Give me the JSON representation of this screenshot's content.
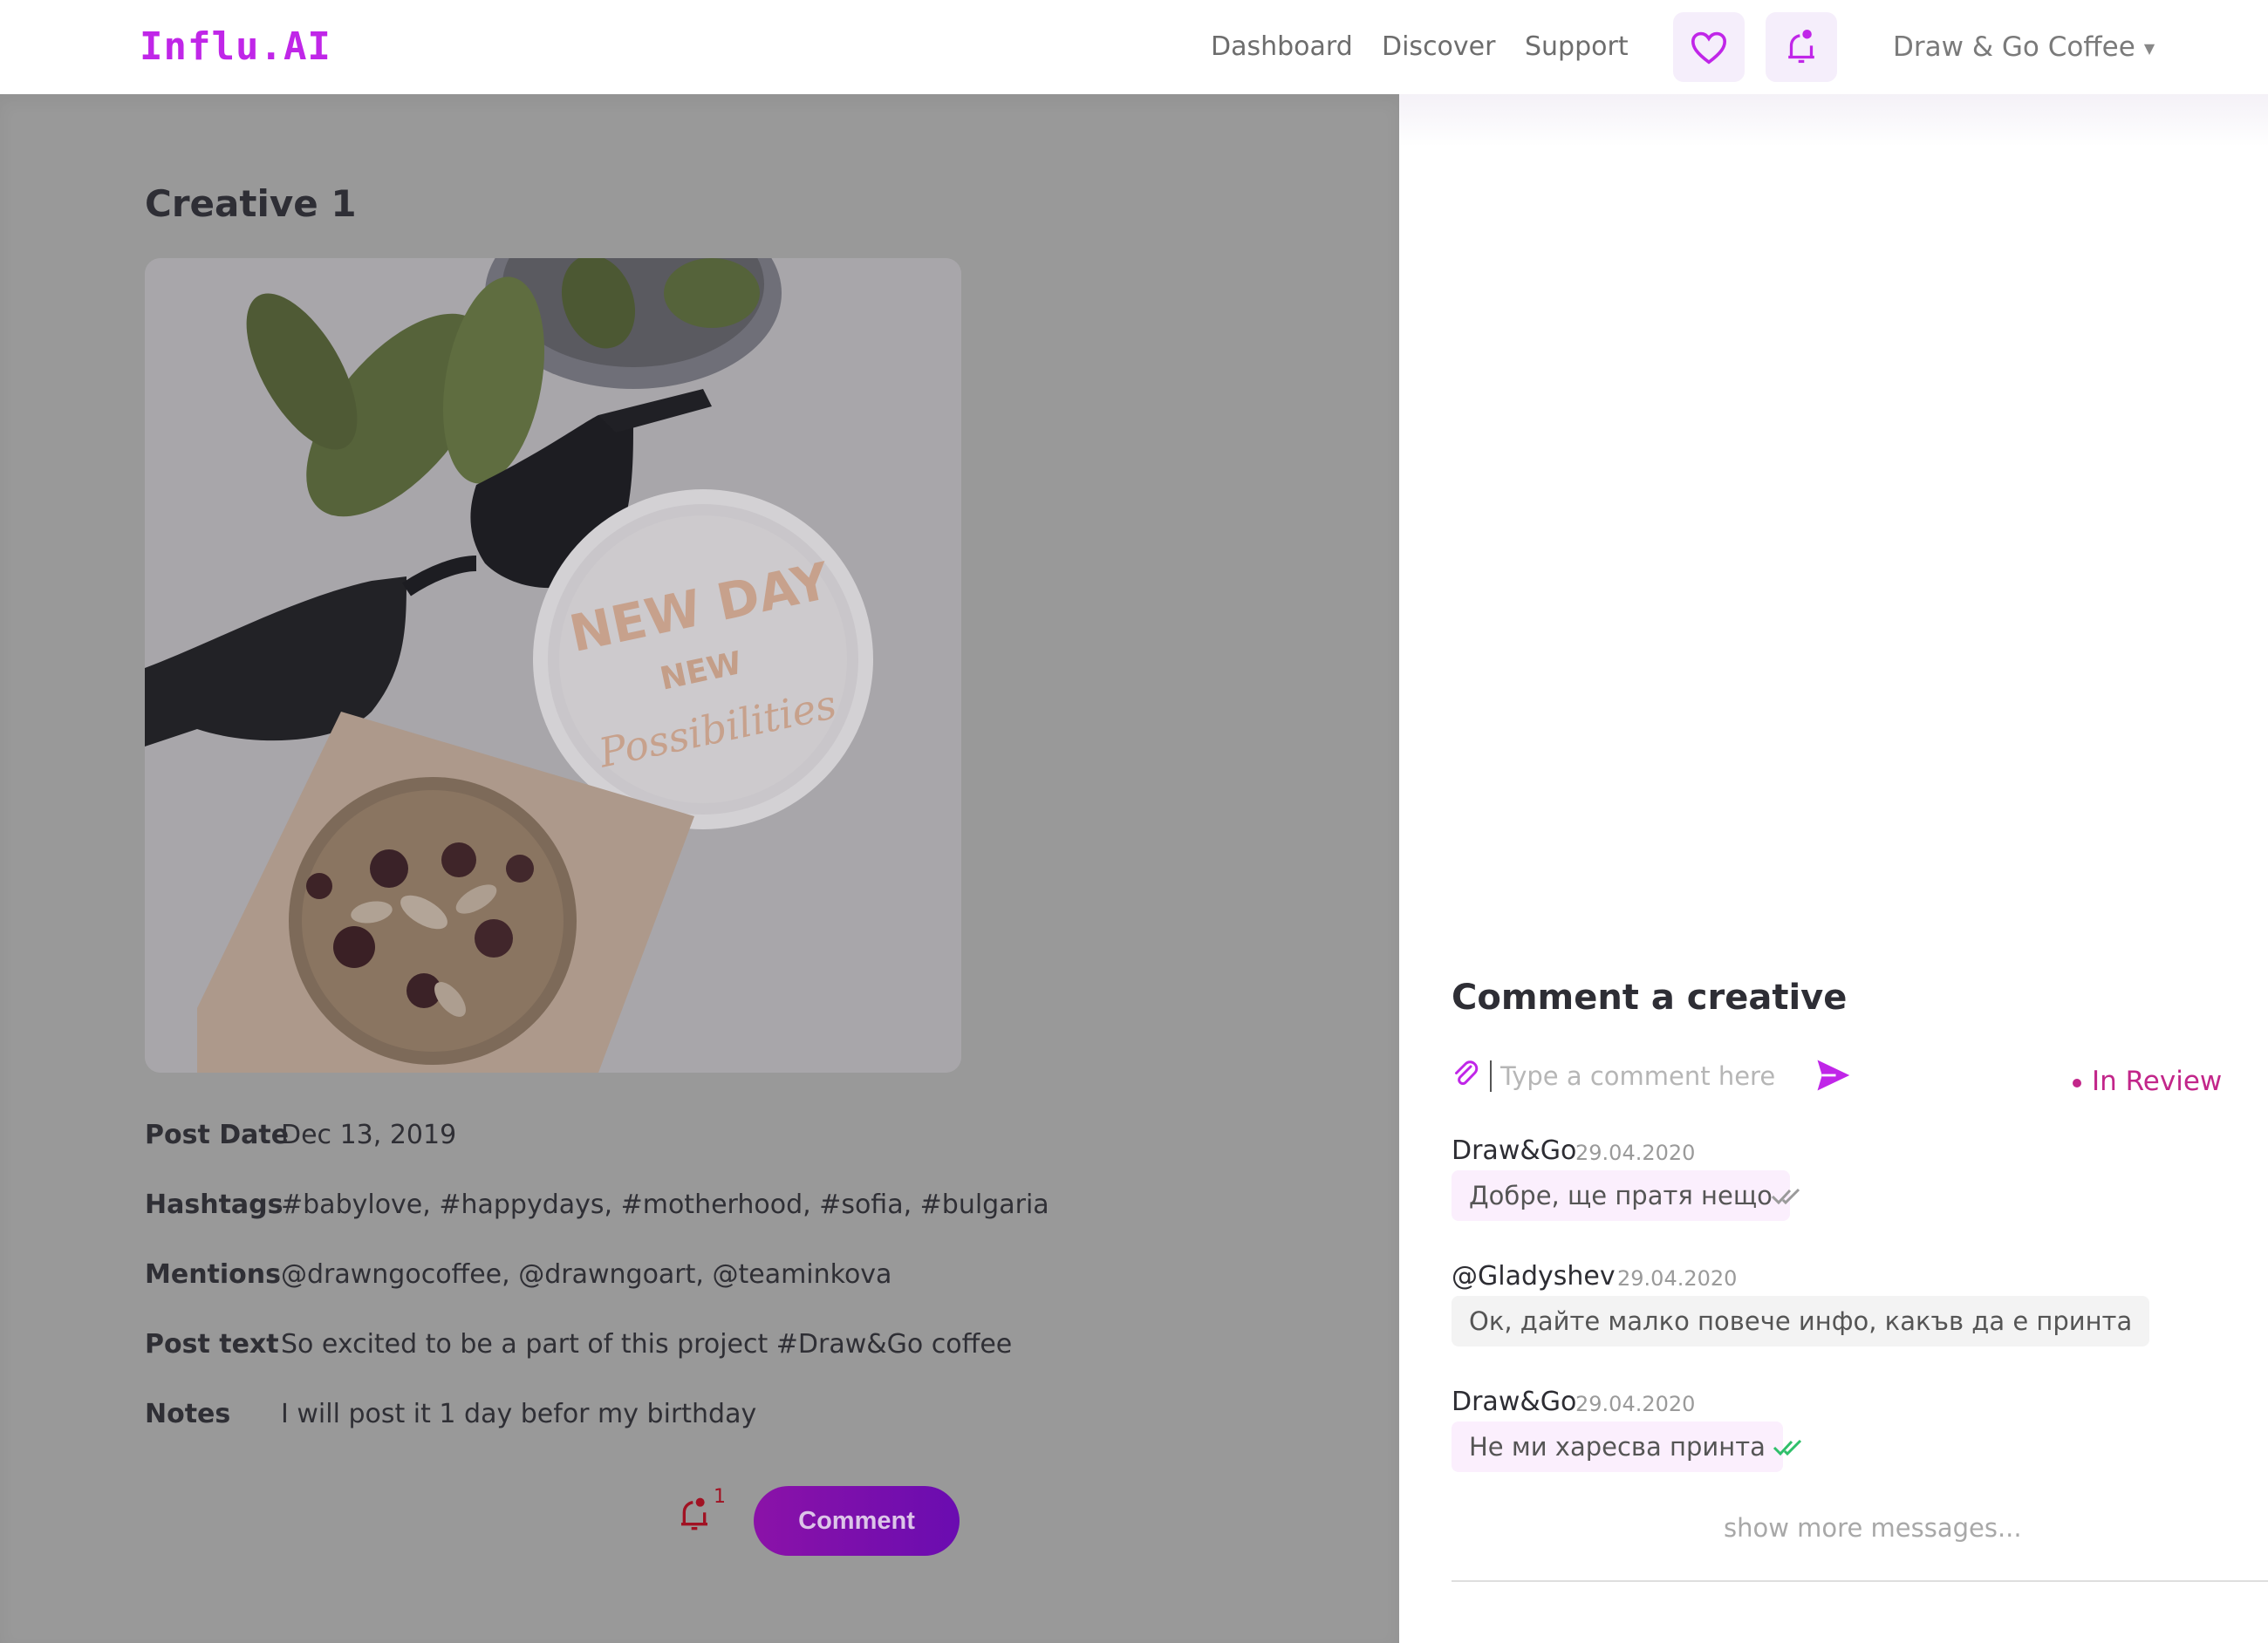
{
  "header": {
    "logo": "Influ.AI",
    "nav": [
      "Dashboard",
      "Discover",
      "Support"
    ],
    "account_name": "Draw & Go Coffee",
    "icons": [
      "heart-icon",
      "bell-icon"
    ],
    "accent_color": "#c026e8"
  },
  "creative": {
    "title": "Creative 1",
    "image_text": [
      "NEW DAY",
      "NEW",
      "Possibilities"
    ],
    "details": [
      {
        "label": "Post Date",
        "value": "Dec 13, 2019"
      },
      {
        "label": "Hashtags",
        "value": "#babylove, #happydays, #motherhood, #sofia, #bulgaria"
      },
      {
        "label": "Mentions",
        "value": "@drawngocoffee, @drawngoart, @teaminkova"
      },
      {
        "label": "Post text",
        "value": "So excited to be a part of this project #Draw&Go coffee"
      },
      {
        "label": "Notes",
        "value": "I will post it 1 day befor my birthday"
      }
    ],
    "notification_count": "1",
    "comment_button": "Comment"
  },
  "comments": {
    "heading": "Comment a creative",
    "input_placeholder": "Type a comment here",
    "status": "In Review",
    "status_color": "#c2268a",
    "messages": [
      {
        "author": "Draw&Go",
        "date": "29.04.2020",
        "text": "Добре, ще пратя нещо",
        "receipt": "read-gray"
      },
      {
        "author": "@Gladyshev",
        "date": "29.04.2020",
        "text": "Ок, дайте малко повече инфо, какъв да е принта",
        "receipt": ""
      },
      {
        "author": "Draw&Go",
        "date": "29.04.2020",
        "text": "Не ми харесва принта",
        "receipt": "read-green"
      }
    ],
    "show_more": "show more messages..."
  }
}
